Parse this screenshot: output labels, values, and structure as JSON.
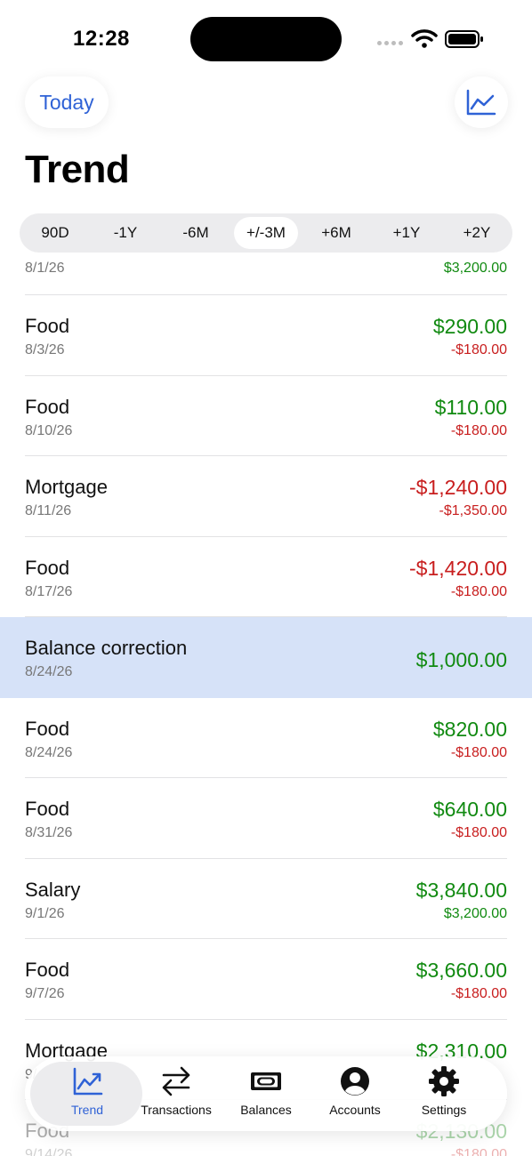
{
  "status_bar": {
    "time": "12:28"
  },
  "header": {
    "today_label": "Today",
    "title": "Trend"
  },
  "segments": [
    {
      "label": "90D",
      "active": false
    },
    {
      "label": "-1Y",
      "active": false
    },
    {
      "label": "-6M",
      "active": false
    },
    {
      "label": "+/-3M",
      "active": true
    },
    {
      "label": "+6M",
      "active": false
    },
    {
      "label": "+1Y",
      "active": false
    },
    {
      "label": "+2Y",
      "active": false
    }
  ],
  "transactions": [
    {
      "name": "",
      "date": "8/1/26",
      "balance": "",
      "amount": "$3,200.00",
      "amount_sign": "positive"
    },
    {
      "name": "Food",
      "date": "8/3/26",
      "balance": "$290.00",
      "balance_sign": "positive",
      "amount": "-$180.00",
      "amount_sign": "negative"
    },
    {
      "name": "Food",
      "date": "8/10/26",
      "balance": "$110.00",
      "balance_sign": "positive",
      "amount": "-$180.00",
      "amount_sign": "negative"
    },
    {
      "name": "Mortgage",
      "date": "8/11/26",
      "balance": "-$1,240.00",
      "balance_sign": "negative",
      "amount": "-$1,350.00",
      "amount_sign": "negative"
    },
    {
      "name": "Food",
      "date": "8/17/26",
      "balance": "-$1,420.00",
      "balance_sign": "negative",
      "amount": "-$180.00",
      "amount_sign": "negative"
    },
    {
      "name": "Balance correction",
      "date": "8/24/26",
      "balance": "$1,000.00",
      "balance_sign": "positive",
      "amount": "",
      "highlighted": true
    },
    {
      "name": "Food",
      "date": "8/24/26",
      "balance": "$820.00",
      "balance_sign": "positive",
      "amount": "-$180.00",
      "amount_sign": "negative"
    },
    {
      "name": "Food",
      "date": "8/31/26",
      "balance": "$640.00",
      "balance_sign": "positive",
      "amount": "-$180.00",
      "amount_sign": "negative"
    },
    {
      "name": "Salary",
      "date": "9/1/26",
      "balance": "$3,840.00",
      "balance_sign": "positive",
      "amount": "$3,200.00",
      "amount_sign": "positive"
    },
    {
      "name": "Food",
      "date": "9/7/26",
      "balance": "$3,660.00",
      "balance_sign": "positive",
      "amount": "-$180.00",
      "amount_sign": "negative"
    },
    {
      "name": "Mortgage",
      "date": "9/",
      "balance": "$2,310.00",
      "balance_sign": "positive",
      "amount": "",
      "amount_sign": "negative"
    },
    {
      "name": "Food",
      "date": "9/14/26",
      "balance": "$2,130.00",
      "balance_sign": "positive",
      "amount": "-$180.00",
      "amount_sign": "negative"
    }
  ],
  "tabbar": {
    "tabs": [
      {
        "label": "Trend",
        "icon": "trend-chart-icon",
        "active": true
      },
      {
        "label": "Transactions",
        "icon": "arrows-swap-icon",
        "active": false
      },
      {
        "label": "Balances",
        "icon": "banknote-icon",
        "active": false
      },
      {
        "label": "Accounts",
        "icon": "person-circle-icon",
        "active": false
      },
      {
        "label": "Settings",
        "icon": "gear-icon",
        "active": false
      }
    ]
  },
  "colors": {
    "accent": "#2f62d6",
    "positive": "#118a11",
    "negative": "#c81e1e",
    "highlight": "#d6e2f8"
  }
}
